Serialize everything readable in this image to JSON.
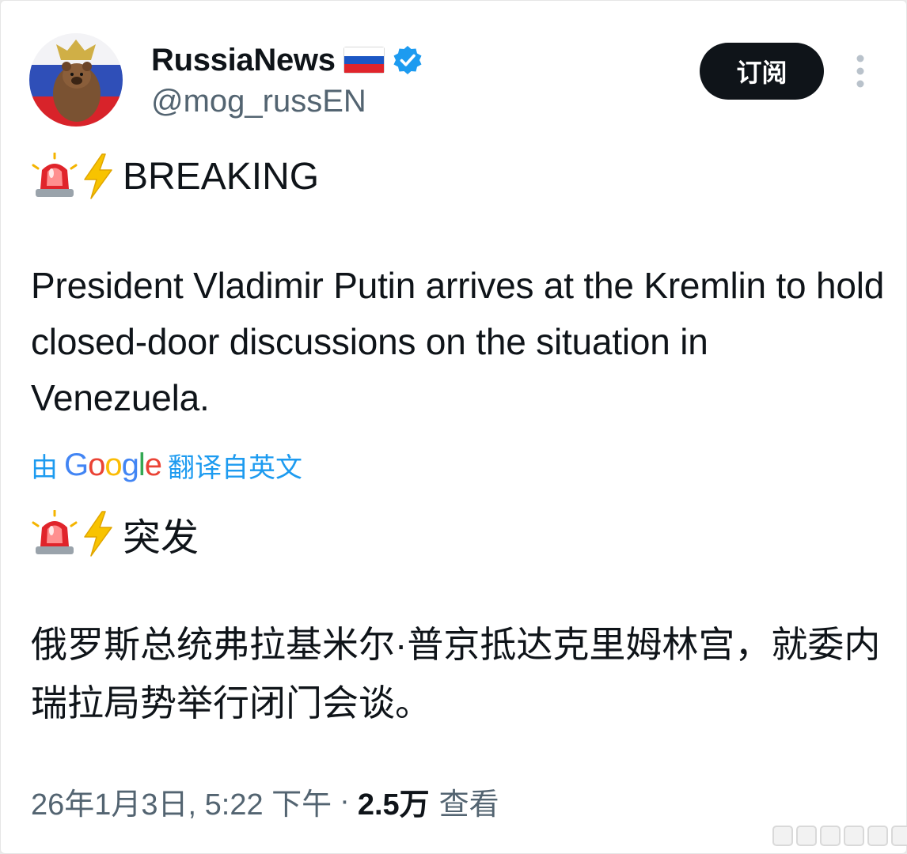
{
  "author": {
    "display_name": "RussiaNews",
    "handle": "@mog_russEN",
    "avatar_icon": "bear-avatar-icon",
    "flag_icon": "russia-flag-icon",
    "verified_icon": "verified-badge-icon"
  },
  "actions": {
    "subscribe_label": "订阅",
    "more_icon": "more-vertical-icon"
  },
  "tweet": {
    "headline": "BREAKING",
    "body": "President Vladimir Putin arrives at the Kremlin to hold closed-door discussions on the situation in Venezuela.",
    "translation_prefix": "由",
    "translation_provider": "Google",
    "translation_suffix": "翻译自英文",
    "translated_headline": "突发",
    "translated_body": "俄罗斯总统弗拉基米尔·普京抵达克里姆林宫，就委内瑞拉局势举行闭门会谈。",
    "emojis": [
      "siren-icon",
      "lightning-icon"
    ]
  },
  "meta": {
    "timestamp": "26年1月3日, 5:22 下午",
    "separator": "·",
    "view_count": "2.5万",
    "view_label": "查看"
  },
  "colors": {
    "text": "#0f1419",
    "secondary": "#536471",
    "link": "#1d9bf0",
    "button_bg": "#0f1419",
    "verified": "#1d9bf0"
  }
}
